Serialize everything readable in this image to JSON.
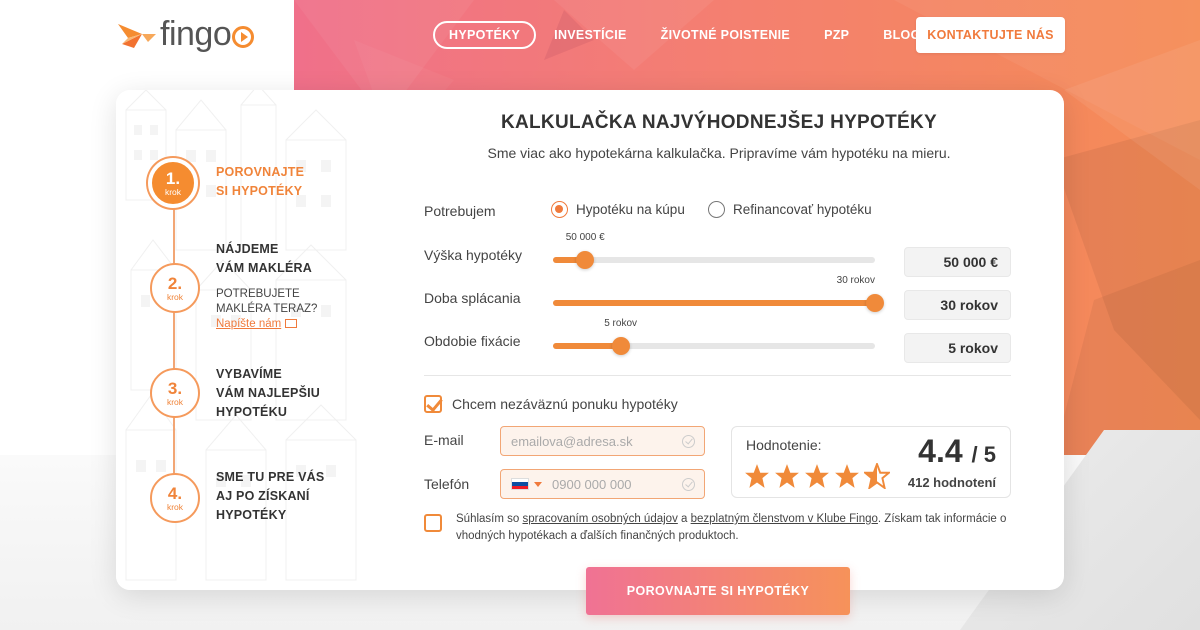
{
  "brand": {
    "name": "fingo",
    "accent": "#f58c30",
    "gradient_start": "#f0708a",
    "gradient_end": "#f58c55"
  },
  "nav": {
    "items": [
      {
        "label": "HYPOTÉKY",
        "active": true
      },
      {
        "label": "INVESTÍCIE",
        "active": false
      },
      {
        "label": "ŽIVOTNÉ POISTENIE",
        "active": false
      },
      {
        "label": "PZP",
        "active": false
      },
      {
        "label": "BLOG",
        "active": false
      }
    ],
    "contact_label": "KONTAKTUJTE NÁS"
  },
  "steps": [
    {
      "num": "1.",
      "sub": "krok",
      "text_line1": "POROVNAJTE",
      "text_line2": "SI HYPOTÉKY",
      "active": true
    },
    {
      "num": "2.",
      "sub": "krok",
      "text_line1": "NÁJDEME",
      "text_line2": "VÁM MAKLÉRA",
      "note_line1": "POTREBUJETE",
      "note_line2": "MAKLÉRA TERAZ?",
      "link": "Napíšte nám"
    },
    {
      "num": "3.",
      "sub": "krok",
      "text_line1": "VYBAVÍME",
      "text_line2": "VÁM NAJLEPŠIU",
      "text_line3": "HYPOTÉKU"
    },
    {
      "num": "4.",
      "sub": "krok",
      "text_line1": "SME TU PRE VÁS",
      "text_line2": "AJ PO ZÍSKANÍ",
      "text_line3": "HYPOTÉKY"
    }
  ],
  "form": {
    "title": "KALKULAČKA NAJVÝHODNEJŠEJ HYPOTÉKY",
    "subtitle": "Sme viac ako hypotekárna kalkulačka. Pripravíme vám hypotéku na mieru.",
    "need_label": "Potrebujem",
    "radio_options": [
      {
        "label": "Hypotéku na kúpu",
        "selected": true
      },
      {
        "label": "Refinancovať hypotéku",
        "selected": false
      }
    ],
    "amount": {
      "label": "Výška hypotéky",
      "tip": "50 000 €",
      "value": "50 000 €",
      "fraction": 0.1
    },
    "duration": {
      "label": "Doba splácania",
      "tip": "30 rokov",
      "value": "30 rokov",
      "fraction": 1.0
    },
    "fixation": {
      "label": "Obdobie fixácie",
      "tip": "5 rokov",
      "value": "5 rokov",
      "fraction": 0.21
    },
    "offer_checkbox": {
      "label": "Chcem nezáväznú ponuku hypotéky",
      "checked": true
    },
    "email": {
      "label": "E-mail",
      "placeholder": "emailova@adresa.sk"
    },
    "phone": {
      "label": "Telefón",
      "placeholder": "0900 000 000"
    },
    "consent": {
      "checked": false,
      "prefix": "Súhlasím so ",
      "link1": "spracovaním osobných údajov",
      "middle": " a ",
      "link2": "bezplatným členstvom v Klube Fingo",
      "suffix": ". Získam tak informácie o vhodných hypotékach a ďalších finančných produktoch."
    },
    "submit_label": "POROVNAJTE SI HYPOTÉKY"
  },
  "rating": {
    "label": "Hodnotenie:",
    "score": "4.4",
    "max": "/ 5",
    "count": "412 hodnotení",
    "stars": 4.4
  }
}
